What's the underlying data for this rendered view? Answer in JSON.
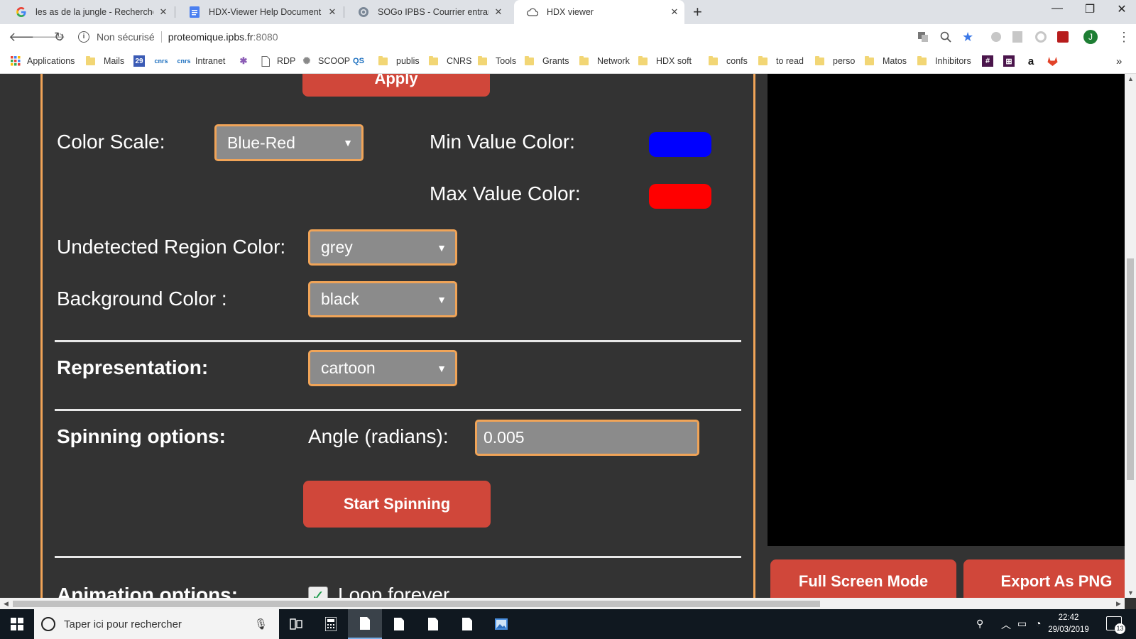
{
  "browser": {
    "tabs": [
      {
        "title": "les as de la jungle - Recherche Go",
        "icon": "google-g-icon",
        "active": false
      },
      {
        "title": "HDX-Viewer Help Document - Go",
        "icon": "google-docs-icon",
        "active": false
      },
      {
        "title": "SOGo IPBS - Courrier entrant",
        "icon": "mail-globe-icon",
        "active": false
      },
      {
        "title": "HDX viewer",
        "icon": "cloud-page-icon",
        "active": true
      }
    ],
    "security_label": "Non sécurisé",
    "url_host": "proteomique.ipbs.fr",
    "url_port": ":8080",
    "bookmarks": [
      {
        "label": "Applications",
        "icon": "apps-grid-icon"
      },
      {
        "label": "Mails",
        "icon": "folder-icon"
      },
      {
        "label": "",
        "icon": "calendar-icon",
        "badge": "29"
      },
      {
        "label": "",
        "icon": "cnrs-icon"
      },
      {
        "label": "Intranet",
        "icon": "intranet-icon"
      },
      {
        "label": "",
        "icon": "star-logo-icon"
      },
      {
        "label": "RDP",
        "icon": "page-icon"
      },
      {
        "label": "SCOOP",
        "icon": "scoop-icon"
      },
      {
        "label": "",
        "icon": "qs-icon"
      },
      {
        "label": "publis",
        "icon": "folder-icon"
      },
      {
        "label": "CNRS",
        "icon": "folder-icon"
      },
      {
        "label": "Tools",
        "icon": "folder-icon"
      },
      {
        "label": "Grants",
        "icon": "folder-icon"
      },
      {
        "label": "Network",
        "icon": "folder-icon"
      },
      {
        "label": "HDX soft",
        "icon": "folder-icon"
      },
      {
        "label": "confs",
        "icon": "folder-icon"
      },
      {
        "label": "to read",
        "icon": "folder-icon"
      },
      {
        "label": "perso",
        "icon": "folder-icon"
      },
      {
        "label": "Matos",
        "icon": "folder-icon"
      },
      {
        "label": "Inhibitors",
        "icon": "folder-icon"
      }
    ],
    "avatar_letter": "J",
    "overflow_chevron": "»"
  },
  "settings": {
    "apply_label": "Apply",
    "color_scale_label": "Color Scale:",
    "color_scale_value": "Blue-Red",
    "min_color_label": "Min Value Color:",
    "min_color": "#0000ff",
    "max_color_label": "Max Value Color:",
    "max_color": "#ff0000",
    "undetected_label": "Undetected Region Color:",
    "undetected_value": "grey",
    "background_label": "Background Color :",
    "background_value": "black",
    "representation_label": "Representation:",
    "representation_value": "cartoon",
    "spinning_label": "Spinning options:",
    "angle_label": "Angle (radians):",
    "angle_value": "0.005",
    "start_spinning_label": "Start Spinning",
    "animation_label": "Animation options:",
    "loop_label": "Loop forever",
    "loop_checked": true
  },
  "viewer": {
    "fullscreen_label": "Full Screen Mode",
    "export_label": "Export As PNG",
    "background": "#000000"
  },
  "taskbar": {
    "search_placeholder": "Taper ici pour rechercher",
    "time": "22:42",
    "date": "29/03/2019",
    "notification_count": "13"
  },
  "colors": {
    "accent_orange": "#f0a458",
    "button_red": "#d0473a",
    "panel_bg": "#333333"
  }
}
